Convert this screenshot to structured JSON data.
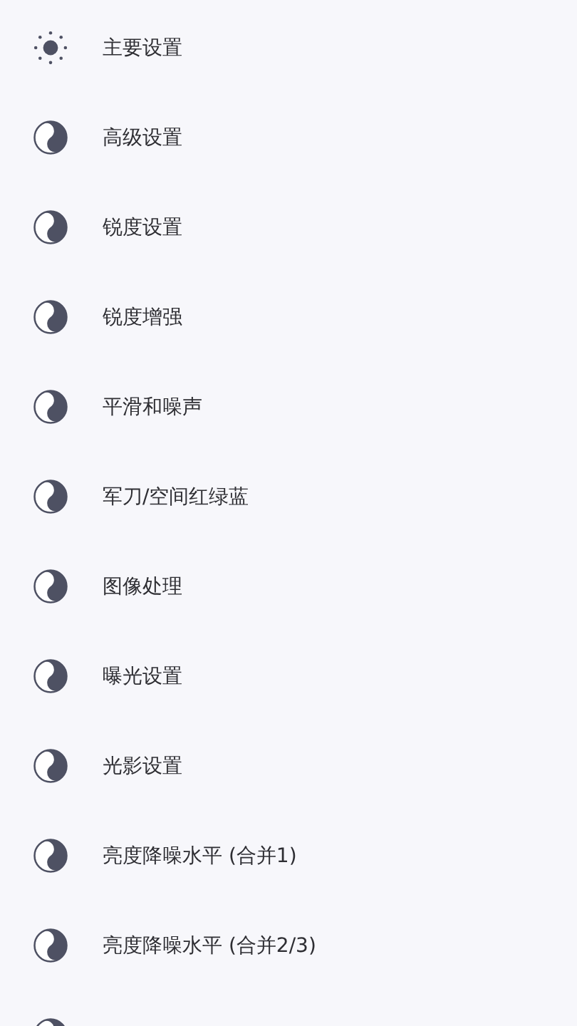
{
  "items": [
    {
      "kind": "sun",
      "label": "主要设置"
    },
    {
      "kind": "yinyang",
      "label": "高级设置"
    },
    {
      "kind": "yinyang",
      "label": "锐度设置"
    },
    {
      "kind": "yinyang",
      "label": "锐度增强"
    },
    {
      "kind": "yinyang",
      "label": "平滑和噪声"
    },
    {
      "kind": "yinyang",
      "label": "军刀/空间红绿蓝"
    },
    {
      "kind": "yinyang",
      "label": "图像处理"
    },
    {
      "kind": "yinyang",
      "label": "曝光设置"
    },
    {
      "kind": "yinyang",
      "label": "光影设置"
    },
    {
      "kind": "yinyang",
      "label": "亮度降噪水平 (合并1)"
    },
    {
      "kind": "yinyang",
      "label": "亮度降噪水平 (合并2/3)"
    },
    {
      "kind": "yinyang"
    }
  ]
}
